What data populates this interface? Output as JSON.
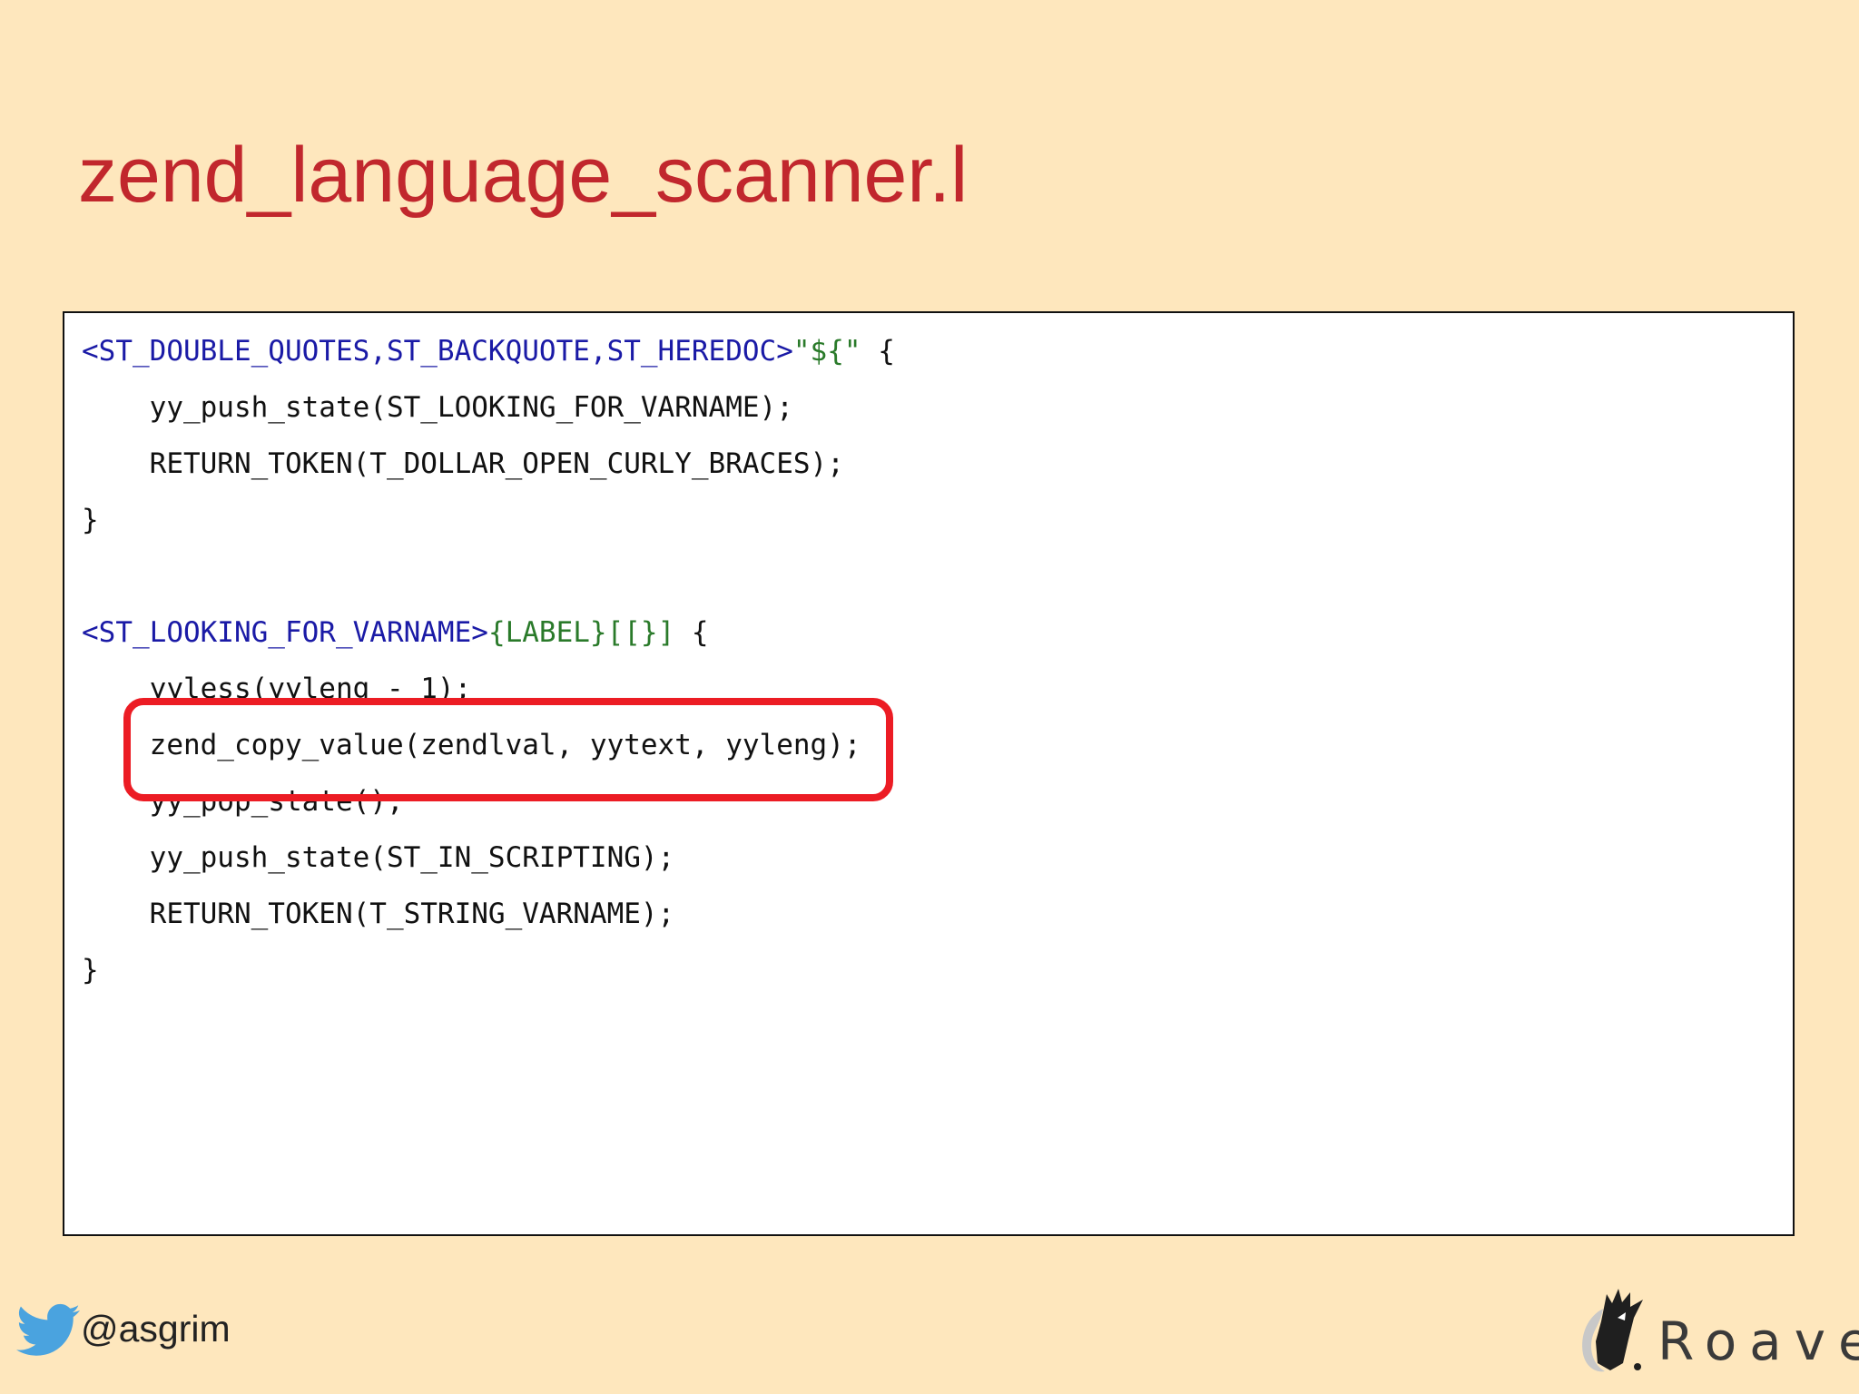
{
  "slide": {
    "title": "zend_language_scanner.l"
  },
  "code": {
    "l1": {
      "state": "<ST_DOUBLE_QUOTES,ST_BACKQUOTE,ST_HEREDOC>",
      "pattern": "\"${\"",
      "rest": " {"
    },
    "l2": "    yy_push_state(ST_LOOKING_FOR_VARNAME);",
    "l3": "    RETURN_TOKEN(T_DOLLAR_OPEN_CURLY_BRACES);",
    "l4": "}",
    "l5": {
      "state": "<ST_LOOKING_FOR_VARNAME>",
      "pattern": "{LABEL}[[}]",
      "rest": " {"
    },
    "l6": "    yyless(yyleng - 1);",
    "l7": "    zend_copy_value(zendlval, yytext, yyleng);",
    "l8": "    yy_pop_state();",
    "l9": "    yy_push_state(ST_IN_SCRIPTING);",
    "l10": "    RETURN_TOKEN(T_STRING_VARNAME);",
    "l11": "}"
  },
  "footer": {
    "handle": "@asgrim",
    "brand": "Roave",
    "twitter_icon": "twitter-bird-icon",
    "brand_icon": "roave-logo-icon"
  },
  "colors": {
    "background": "#fee7bd",
    "title": "#c1272d",
    "state_keyword": "#1a1aa6",
    "pattern_string": "#2a7a2a",
    "highlight": "#ec1c24",
    "twitter": "#4aa3df"
  }
}
